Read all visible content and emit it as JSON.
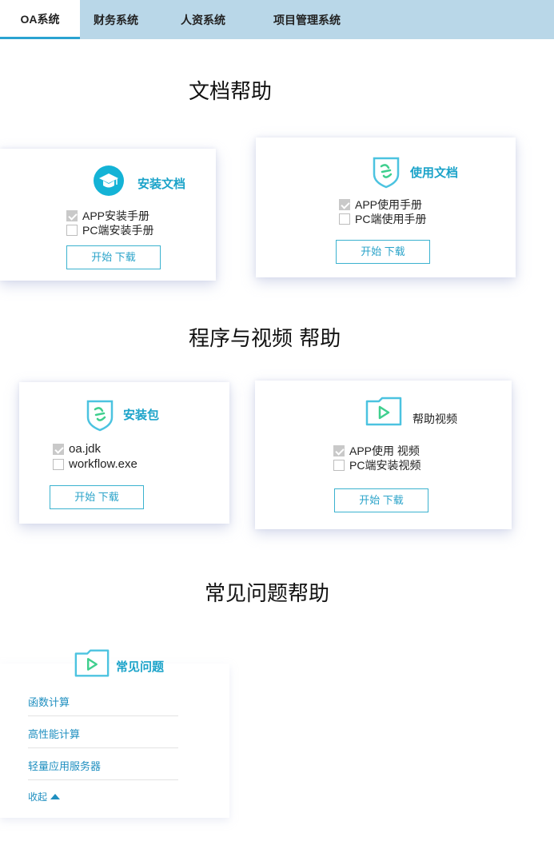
{
  "tabs": [
    "OA系统",
    "财务系统",
    "人资系统",
    "项目管理系统"
  ],
  "sections": {
    "docs": "文档帮助",
    "programs": "程序与视频 帮助",
    "faq": "常见问题帮助"
  },
  "cards": {
    "install_docs": {
      "title": "安装文档",
      "options": [
        {
          "label": "APP安装手册",
          "checked": true
        },
        {
          "label": "PC端安装手册",
          "checked": false
        }
      ],
      "button": "开始 下载"
    },
    "usage_docs": {
      "title": "使用文档",
      "options": [
        {
          "label": "APP使用手册",
          "checked": true
        },
        {
          "label": "PC端使用手册",
          "checked": false
        }
      ],
      "button": "开始 下载"
    },
    "packages": {
      "title": "安装包",
      "options": [
        {
          "label": "oa.jdk",
          "checked": true
        },
        {
          "label": "workflow.exe",
          "checked": false
        }
      ],
      "button": "开始 下载"
    },
    "videos": {
      "title": "帮助视频",
      "options": [
        {
          "label": "APP使用 视频",
          "checked": true
        },
        {
          "label": "PC端安装视频",
          "checked": false
        }
      ],
      "button": "开始 下载"
    },
    "faq": {
      "title": "常见问题",
      "items": [
        "函数计算",
        "高性能计算",
        "轻量应用服务器"
      ],
      "collapse": "收起"
    }
  },
  "icons": {
    "install_docs": "graduation-cap-icon",
    "usage_docs": "shield-logo-icon",
    "packages": "shield-logo-icon",
    "videos": "video-folder-icon",
    "faq": "video-folder-icon"
  },
  "colors": {
    "accent": "#1ba3c9",
    "tabbar": "#b9d7e8",
    "icon_green": "#3fcf8e",
    "icon_blue": "#4cc3e0"
  }
}
